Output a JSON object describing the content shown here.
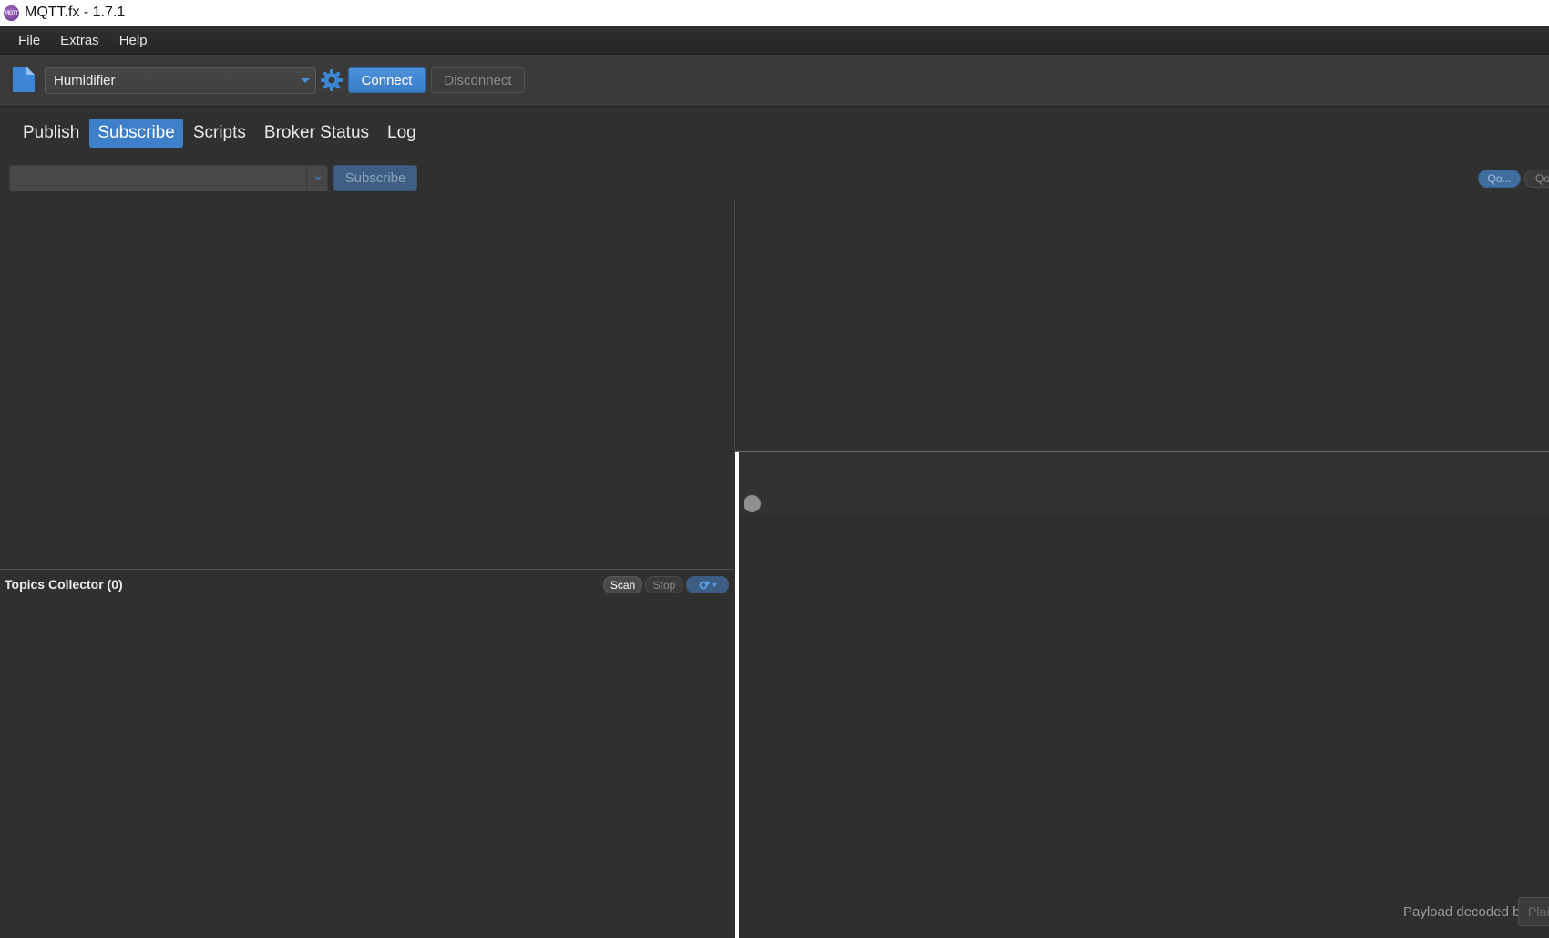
{
  "window": {
    "title": "MQTT.fx - 1.7.1",
    "logo_text": "MQTT"
  },
  "menu": {
    "items": [
      {
        "label": "File"
      },
      {
        "label": "Extras"
      },
      {
        "label": "Help"
      }
    ]
  },
  "toolbar": {
    "profile": "Humidifier",
    "connect_label": "Connect",
    "disconnect_label": "Disconnect",
    "icons": [
      "file-icon",
      "gear-icon",
      "chevron-down-icon"
    ]
  },
  "tabs": [
    {
      "label": "Publish",
      "active": false
    },
    {
      "label": "Subscribe",
      "active": true
    },
    {
      "label": "Scripts",
      "active": false
    },
    {
      "label": "Broker Status",
      "active": false
    },
    {
      "label": "Log",
      "active": false
    }
  ],
  "subscribe": {
    "topic_value": "",
    "button_label": "Subscribe",
    "qos_pills": [
      "Qo...",
      "Qo"
    ]
  },
  "topics_collector": {
    "title": "Topics Collector (0)",
    "scan_label": "Scan",
    "stop_label": "Stop"
  },
  "payload": {
    "label": "Payload decoded by",
    "decoder": "Plai"
  },
  "colors": {
    "accent": "#3d7fc9",
    "background": "#303030",
    "toolbar": "#3a3a3a"
  }
}
